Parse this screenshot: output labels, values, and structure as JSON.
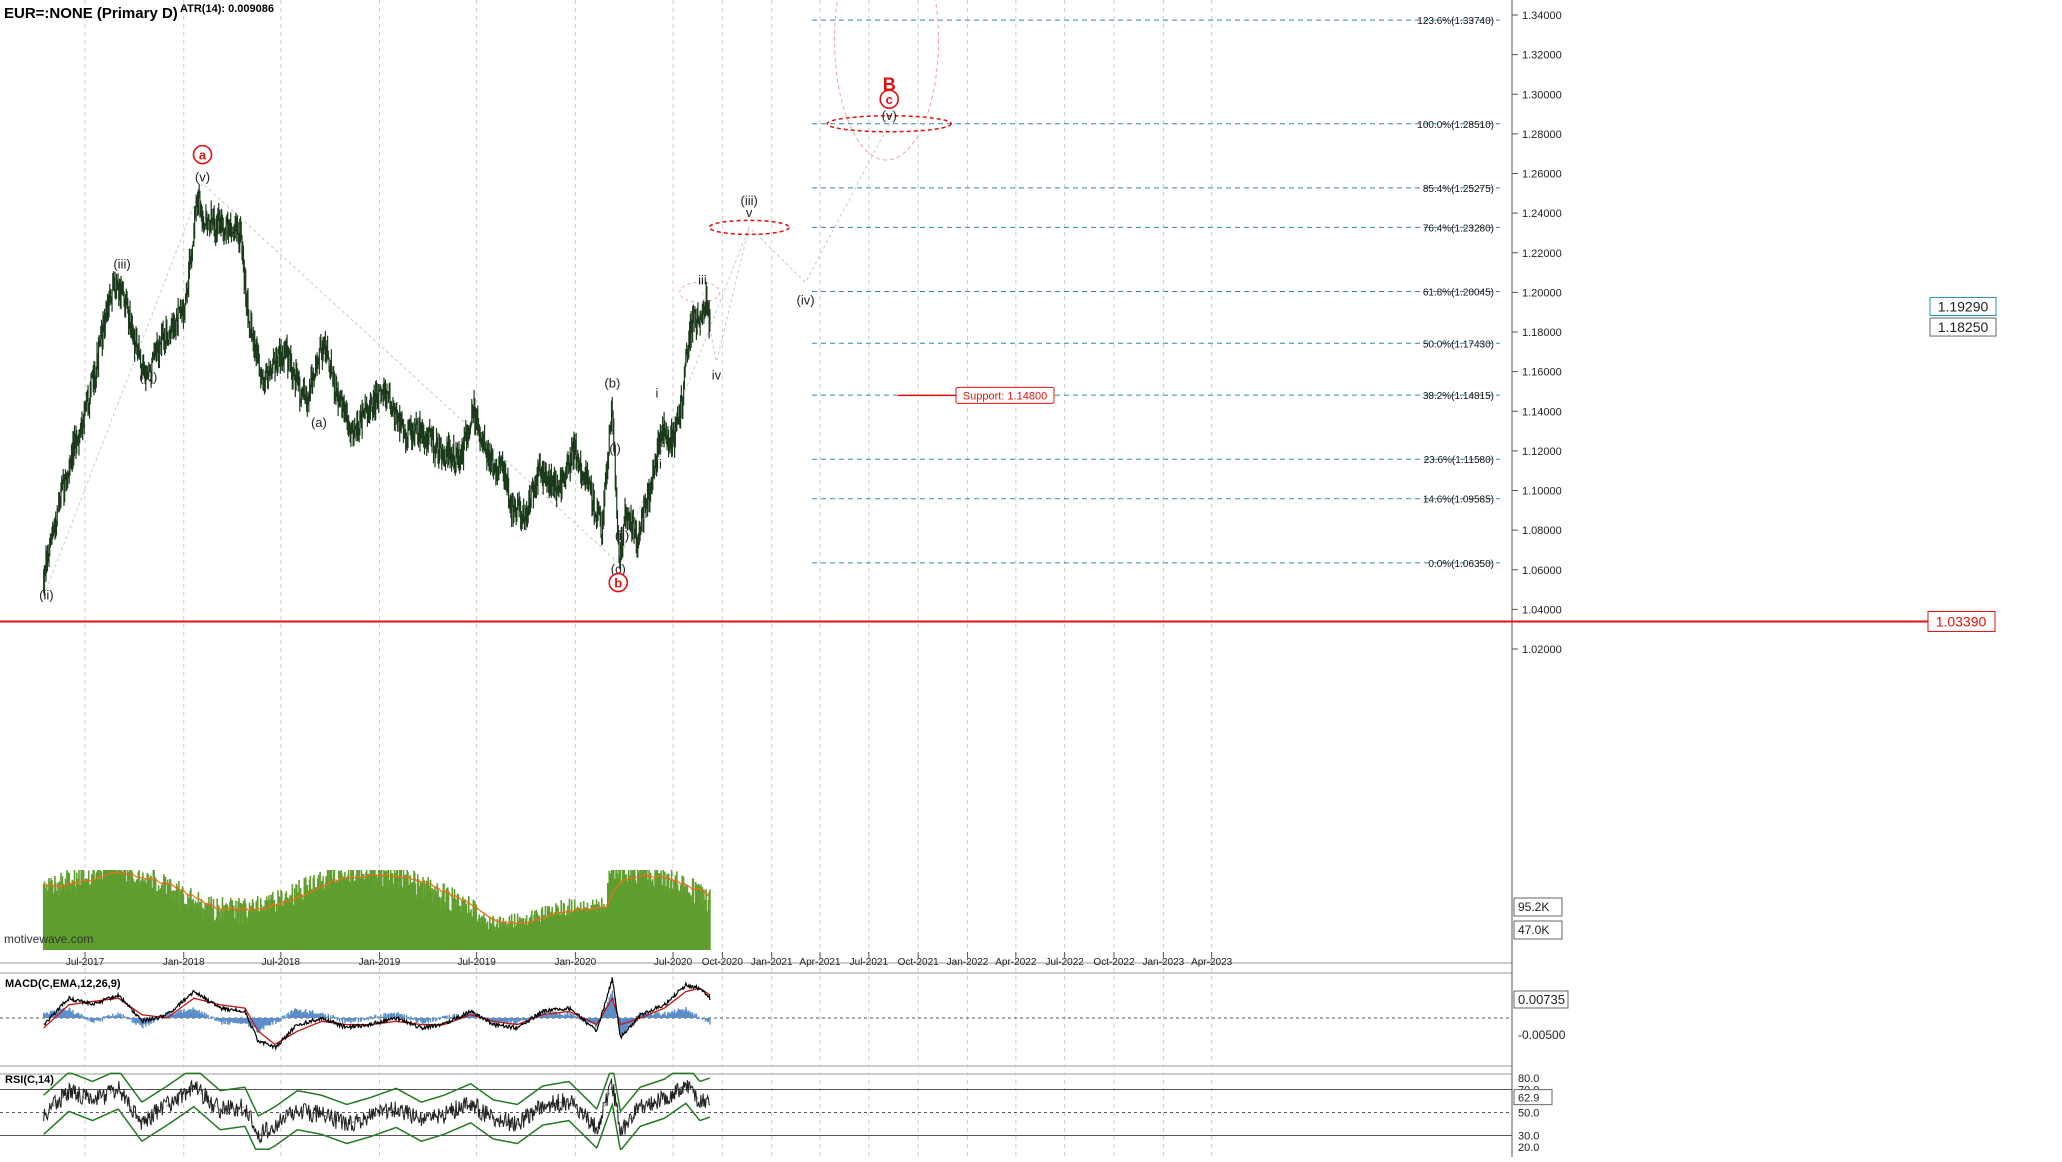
{
  "title": "EUR=:NONE (Primary D)",
  "atr_label": "ATR(14): 0.009086",
  "watermark": "motivewave.com",
  "colors": {
    "price": "#1b3a1b",
    "volume": "#5f9e2e",
    "volume_ma": "#e8701a",
    "fib_line": "#2a8ca8",
    "red": "#e01010",
    "macd_line": "#000000",
    "signal_line": "#c21515",
    "histogram": "#5b8fc9",
    "rsi_line": "#222222",
    "band": "#237a23"
  },
  "chart_data": {
    "type": "line",
    "title": "EUR=:NONE (Primary D)",
    "xlabel": "",
    "ylabel": "",
    "ylim": [
      1.0,
      1.35
    ],
    "x_ticks": [
      "Jul-2017",
      "Jan-2018",
      "Jul-2018",
      "Jan-2019",
      "Jul-2019",
      "Jan-2020",
      "Jul-2020",
      "Oct-2020",
      "Jan-2021",
      "Apr-2021",
      "Jul-2021",
      "Oct-2021",
      "Jan-2022",
      "Apr-2022",
      "Jul-2022",
      "Oct-2022",
      "Jan-2023",
      "Apr-2023"
    ],
    "y_ticks": [
      "1.34000",
      "1.32000",
      "1.30000",
      "1.28000",
      "1.26000",
      "1.24000",
      "1.22000",
      "1.20000",
      "1.18000",
      "1.16000",
      "1.14000",
      "1.12000",
      "1.10000",
      "1.08000",
      "1.06000",
      "1.04000",
      "1.02000"
    ],
    "price_series": {
      "name": "EUR=",
      "x": [
        "2017-04-15",
        "2017-05-15",
        "2017-06-10",
        "2017-07-01",
        "2017-07-20",
        "2017-08-10",
        "2017-08-28",
        "2017-09-20",
        "2017-10-10",
        "2017-10-27",
        "2017-11-20",
        "2017-12-20",
        "2018-01-05",
        "2018-01-25",
        "2018-02-15",
        "2018-03-10",
        "2018-04-15",
        "2018-05-01",
        "2018-05-28",
        "2018-06-15",
        "2018-07-10",
        "2018-08-15",
        "2018-09-20",
        "2018-10-10",
        "2018-11-12",
        "2018-12-10",
        "2019-01-10",
        "2019-02-15",
        "2019-03-20",
        "2019-04-25",
        "2019-05-30",
        "2019-06-25",
        "2019-07-25",
        "2019-08-20",
        "2019-09-03",
        "2019-10-01",
        "2019-10-28",
        "2019-11-29",
        "2019-12-30",
        "2020-01-15",
        "2020-02-20",
        "2020-03-09",
        "2020-03-23",
        "2020-04-05",
        "2020-04-24",
        "2020-05-15",
        "2020-06-10",
        "2020-07-01",
        "2020-07-20",
        "2020-07-31",
        "2020-08-10",
        "2020-08-25",
        "2020-09-01",
        "2020-09-08"
      ],
      "values": [
        1.055,
        1.095,
        1.12,
        1.14,
        1.16,
        1.19,
        1.205,
        1.19,
        1.165,
        1.158,
        1.175,
        1.185,
        1.195,
        1.245,
        1.235,
        1.235,
        1.23,
        1.19,
        1.155,
        1.165,
        1.17,
        1.145,
        1.175,
        1.15,
        1.13,
        1.14,
        1.15,
        1.13,
        1.13,
        1.12,
        1.115,
        1.14,
        1.115,
        1.11,
        1.09,
        1.09,
        1.11,
        1.1,
        1.12,
        1.11,
        1.08,
        1.145,
        1.065,
        1.09,
        1.075,
        1.095,
        1.13,
        1.125,
        1.15,
        1.18,
        1.185,
        1.185,
        1.2,
        1.185
      ]
    },
    "last_price": "1.19290",
    "other_price_label": "1.18250",
    "horizontal_level": "1.03390",
    "fib_levels": [
      {
        "label": "123.6%(1.33740)",
        "value": 1.3374
      },
      {
        "label": "100.0%(1.28510)",
        "value": 1.2851
      },
      {
        "label": "85.4%(1.25275)",
        "value": 1.25275
      },
      {
        "label": "76.4%(1.23280)",
        "value": 1.2328
      },
      {
        "label": "61.8%(1.20045)",
        "value": 1.20045
      },
      {
        "label": "50.0%(1.17430)",
        "value": 1.1743
      },
      {
        "label": "38.2%(1.14815)",
        "value": 1.14815
      },
      {
        "label": "23.6%(1.11580)",
        "value": 1.1158
      },
      {
        "label": "14.6%(1.09585)",
        "value": 1.09585
      },
      {
        "label": "0.0%(1.06350)",
        "value": 1.0635
      }
    ],
    "support": {
      "label": "Support: 1.14800",
      "value": 1.148
    },
    "wave_labels": [
      {
        "text": "(ii)",
        "date": "2017-04-20",
        "value": 1.045,
        "red": false
      },
      {
        "text": "(iii)",
        "date": "2017-09-08",
        "value": 1.212,
        "red": false
      },
      {
        "text": "(iv)",
        "date": "2017-10-27",
        "value": 1.155,
        "red": false
      },
      {
        "text": "(v)",
        "date": "2018-02-05",
        "value": 1.256,
        "red": false
      },
      {
        "text": "a",
        "date": "2018-02-05",
        "value": 1.267,
        "red": true,
        "circled": true
      },
      {
        "text": "(a)",
        "date": "2018-09-10",
        "value": 1.132,
        "red": false
      },
      {
        "text": "(b)",
        "date": "2020-03-10",
        "value": 1.152,
        "red": false
      },
      {
        "text": "(i)",
        "date": "2020-03-15",
        "value": 1.119,
        "red": false
      },
      {
        "text": "(ii)",
        "date": "2020-03-28",
        "value": 1.075,
        "red": false
      },
      {
        "text": "(c)",
        "date": "2020-03-21",
        "value": 1.058,
        "red": false
      },
      {
        "text": "b",
        "date": "2020-03-21",
        "value": 1.051,
        "red": true,
        "circled": true
      },
      {
        "text": "i",
        "date": "2020-06-01",
        "value": 1.147,
        "red": false
      },
      {
        "text": "ii",
        "date": "2020-06-05",
        "value": 1.111,
        "red": false
      },
      {
        "text": "iii",
        "date": "2020-08-25",
        "value": 1.204,
        "red": false
      },
      {
        "text": "iv",
        "date": "2020-09-20",
        "value": 1.156,
        "red": false
      },
      {
        "text": "(iii)",
        "date": "2020-11-20",
        "value": 1.244,
        "red": false
      },
      {
        "text": "v",
        "date": "2020-11-20",
        "value": 1.238,
        "red": false
      },
      {
        "text": "(iv)",
        "date": "2021-03-05",
        "value": 1.194,
        "red": false
      },
      {
        "text": "(v)",
        "date": "2021-08-08",
        "value": 1.287,
        "red": false
      },
      {
        "text": "c",
        "date": "2021-08-08",
        "value": 1.295,
        "red": true,
        "circled": true
      },
      {
        "text": "B",
        "date": "2021-08-08",
        "value": 1.302,
        "red": true,
        "big": true
      }
    ],
    "volume_axis": [
      "95.2K",
      "47.0K"
    ],
    "macd": {
      "title": "MACD(C,EMA,12,26,9)",
      "y_ticks": [
        "0.00735",
        "-0.00500"
      ],
      "last_value": "0.00735",
      "x": [
        "2017-04-15",
        "2017-06-01",
        "2017-07-15",
        "2017-09-01",
        "2017-10-15",
        "2017-12-01",
        "2018-01-20",
        "2018-03-10",
        "2018-04-25",
        "2018-05-20",
        "2018-06-20",
        "2018-08-01",
        "2018-09-15",
        "2018-11-01",
        "2018-12-15",
        "2019-02-01",
        "2019-03-20",
        "2019-05-01",
        "2019-06-20",
        "2019-08-01",
        "2019-09-15",
        "2019-11-01",
        "2019-12-20",
        "2020-02-10",
        "2020-03-10",
        "2020-03-25",
        "2020-05-01",
        "2020-06-15",
        "2020-07-25",
        "2020-08-20",
        "2020-09-08"
      ],
      "macd": [
        -0.002,
        0.006,
        0.004,
        0.007,
        -0.001,
        0.001,
        0.008,
        0.003,
        0.002,
        -0.007,
        -0.009,
        -0.002,
        0.0,
        -0.003,
        -0.002,
        0.0,
        -0.003,
        -0.002,
        0.002,
        -0.002,
        -0.003,
        0.002,
        0.003,
        -0.004,
        0.012,
        -0.006,
        0.001,
        0.004,
        0.01,
        0.009,
        0.006
      ],
      "signal": [
        -0.003,
        0.004,
        0.005,
        0.006,
        0.001,
        0.0,
        0.006,
        0.004,
        0.003,
        -0.004,
        -0.008,
        -0.004,
        -0.001,
        -0.002,
        -0.002,
        -0.001,
        -0.002,
        -0.002,
        0.001,
        -0.001,
        -0.002,
        0.001,
        0.002,
        -0.002,
        0.006,
        -0.002,
        0.0,
        0.003,
        0.008,
        0.009,
        0.007
      ]
    },
    "rsi": {
      "title": "RSI(C,14)",
      "y_ticks": [
        "80.0",
        "70.0",
        "50.0",
        "30.0",
        "20.0"
      ],
      "last_value": "62.9",
      "x": [
        "2017-04-15",
        "2017-06-01",
        "2017-07-15",
        "2017-09-01",
        "2017-10-15",
        "2017-12-01",
        "2018-01-20",
        "2018-03-10",
        "2018-04-25",
        "2018-05-20",
        "2018-06-20",
        "2018-08-01",
        "2018-09-15",
        "2018-11-01",
        "2018-12-15",
        "2019-02-01",
        "2019-03-20",
        "2019-05-01",
        "2019-06-20",
        "2019-08-01",
        "2019-09-15",
        "2019-11-01",
        "2019-12-20",
        "2020-02-10",
        "2020-03-10",
        "2020-03-25",
        "2020-05-01",
        "2020-06-15",
        "2020-07-25",
        "2020-08-20",
        "2020-09-08"
      ],
      "values": [
        48,
        68,
        60,
        70,
        42,
        56,
        72,
        52,
        55,
        30,
        38,
        52,
        48,
        40,
        46,
        54,
        42,
        48,
        58,
        44,
        40,
        56,
        60,
        36,
        74,
        34,
        55,
        62,
        75,
        60,
        63
      ]
    }
  }
}
